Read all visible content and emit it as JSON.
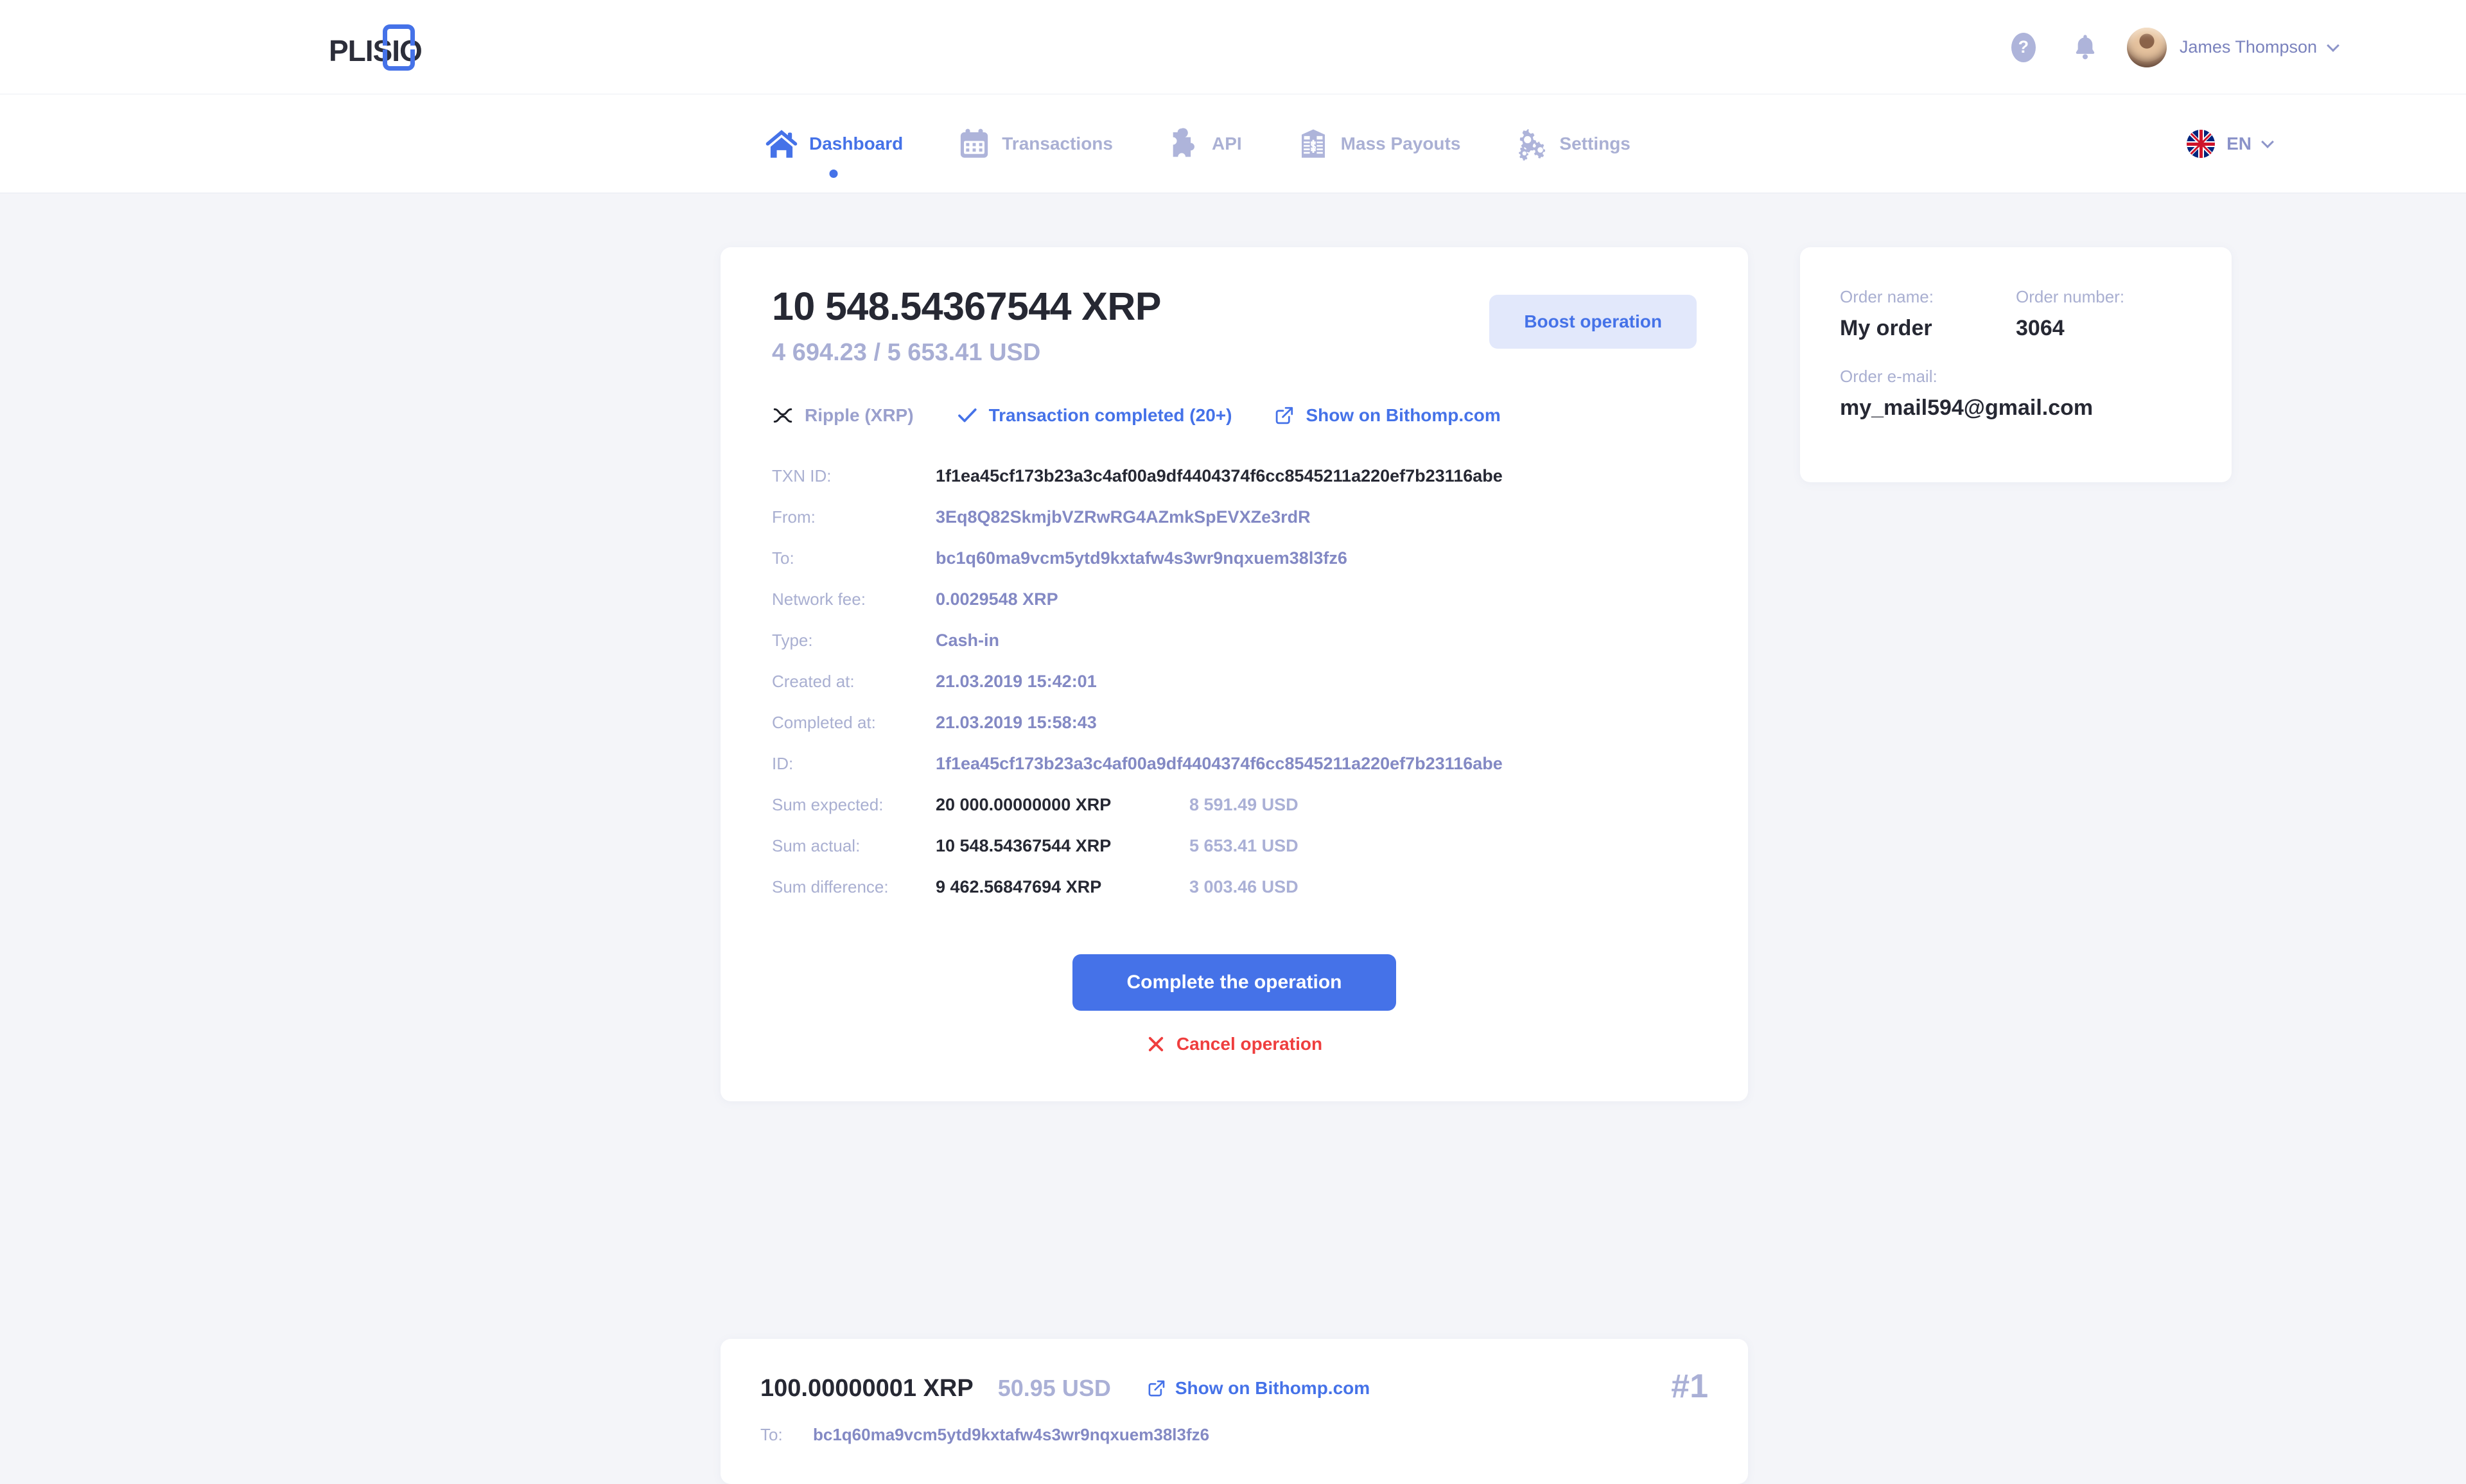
{
  "brand": {
    "name": "PLISIO",
    "accent": "#4572e8"
  },
  "topbar": {
    "help_icon": "help-circle-icon",
    "bell_icon": "bell-icon",
    "user_name": "James Thompson"
  },
  "nav": {
    "items": [
      {
        "label": "Dashboard",
        "icon": "home-icon",
        "active": true
      },
      {
        "label": "Transactions",
        "icon": "calendar-icon",
        "active": false
      },
      {
        "label": "API",
        "icon": "puzzle-icon",
        "active": false
      },
      {
        "label": "Mass Payouts",
        "icon": "banknote-icon",
        "active": false
      },
      {
        "label": "Settings",
        "icon": "gears-icon",
        "active": false
      }
    ],
    "language": {
      "label": "EN",
      "flag": "uk-flag-icon"
    }
  },
  "operation": {
    "amount_crypto": "10 548.54367544 XRP",
    "amount_fiat": "4 694.23 / 5 653.41 USD",
    "boost_label": "Boost operation",
    "network": "Ripple (XRP)",
    "network_icon": "xrp-icon",
    "status": "Transaction completed (20+)",
    "status_icon": "check-icon",
    "explorer_link": "Show on Bithomp.com",
    "explorer_icon": "external-link-icon",
    "details": [
      {
        "label": "TXN ID:",
        "value": "1f1ea45cf173b23a3c4af00a9df4404374f6cc8545211a220ef7b23116abe",
        "style": "dark"
      },
      {
        "label": "From:",
        "value": "3Eq8Q82SkmjbVZRwRG4AZmkSpEVXZe3rdR",
        "style": "purple"
      },
      {
        "label": "To:",
        "value": "bc1q60ma9vcm5ytd9kxtafw4s3wr9nqxuem38l3fz6",
        "style": "purple"
      },
      {
        "label": "Network fee:",
        "value": "0.0029548 XRP",
        "style": "purple"
      },
      {
        "label": "Type:",
        "value": "Cash-in",
        "style": "purple"
      },
      {
        "label": "Created at:",
        "value": "21.03.2019 15:42:01",
        "style": "purple"
      },
      {
        "label": "Completed at:",
        "value": "21.03.2019 15:58:43",
        "style": "purple"
      },
      {
        "label": "ID:",
        "value": "1f1ea45cf173b23a3c4af00a9df4404374f6cc8545211a220ef7b23116abe",
        "style": "purple"
      }
    ],
    "sums": [
      {
        "label": "Sum expected:",
        "crypto": "20 000.00000000 XRP",
        "fiat": "8 591.49 USD"
      },
      {
        "label": "Sum actual:",
        "crypto": "10 548.54367544 XRP",
        "fiat": "5 653.41 USD"
      },
      {
        "label": "Sum difference:",
        "crypto": "9 462.56847694 XRP",
        "fiat": "3 003.46 USD"
      }
    ],
    "complete_label": "Complete the operation",
    "cancel_label": "Cancel operation",
    "cancel_icon": "x-icon"
  },
  "order": {
    "name_label": "Order name:",
    "name_value": "My order",
    "number_label": "Order number:",
    "number_value": "3064",
    "email_label": "Order e-mail:",
    "email_value": "my_mail594@gmail.com"
  },
  "transaction": {
    "amount_crypto": "100.00000001 XRP",
    "amount_fiat": "50.95 USD",
    "explorer_link": "Show on Bithomp.com",
    "explorer_icon": "external-link-icon",
    "index": "#1",
    "to_label": "To:",
    "to_value": "bc1q60ma9vcm5ytd9kxtafw4s3wr9nqxuem38l3fz6"
  }
}
